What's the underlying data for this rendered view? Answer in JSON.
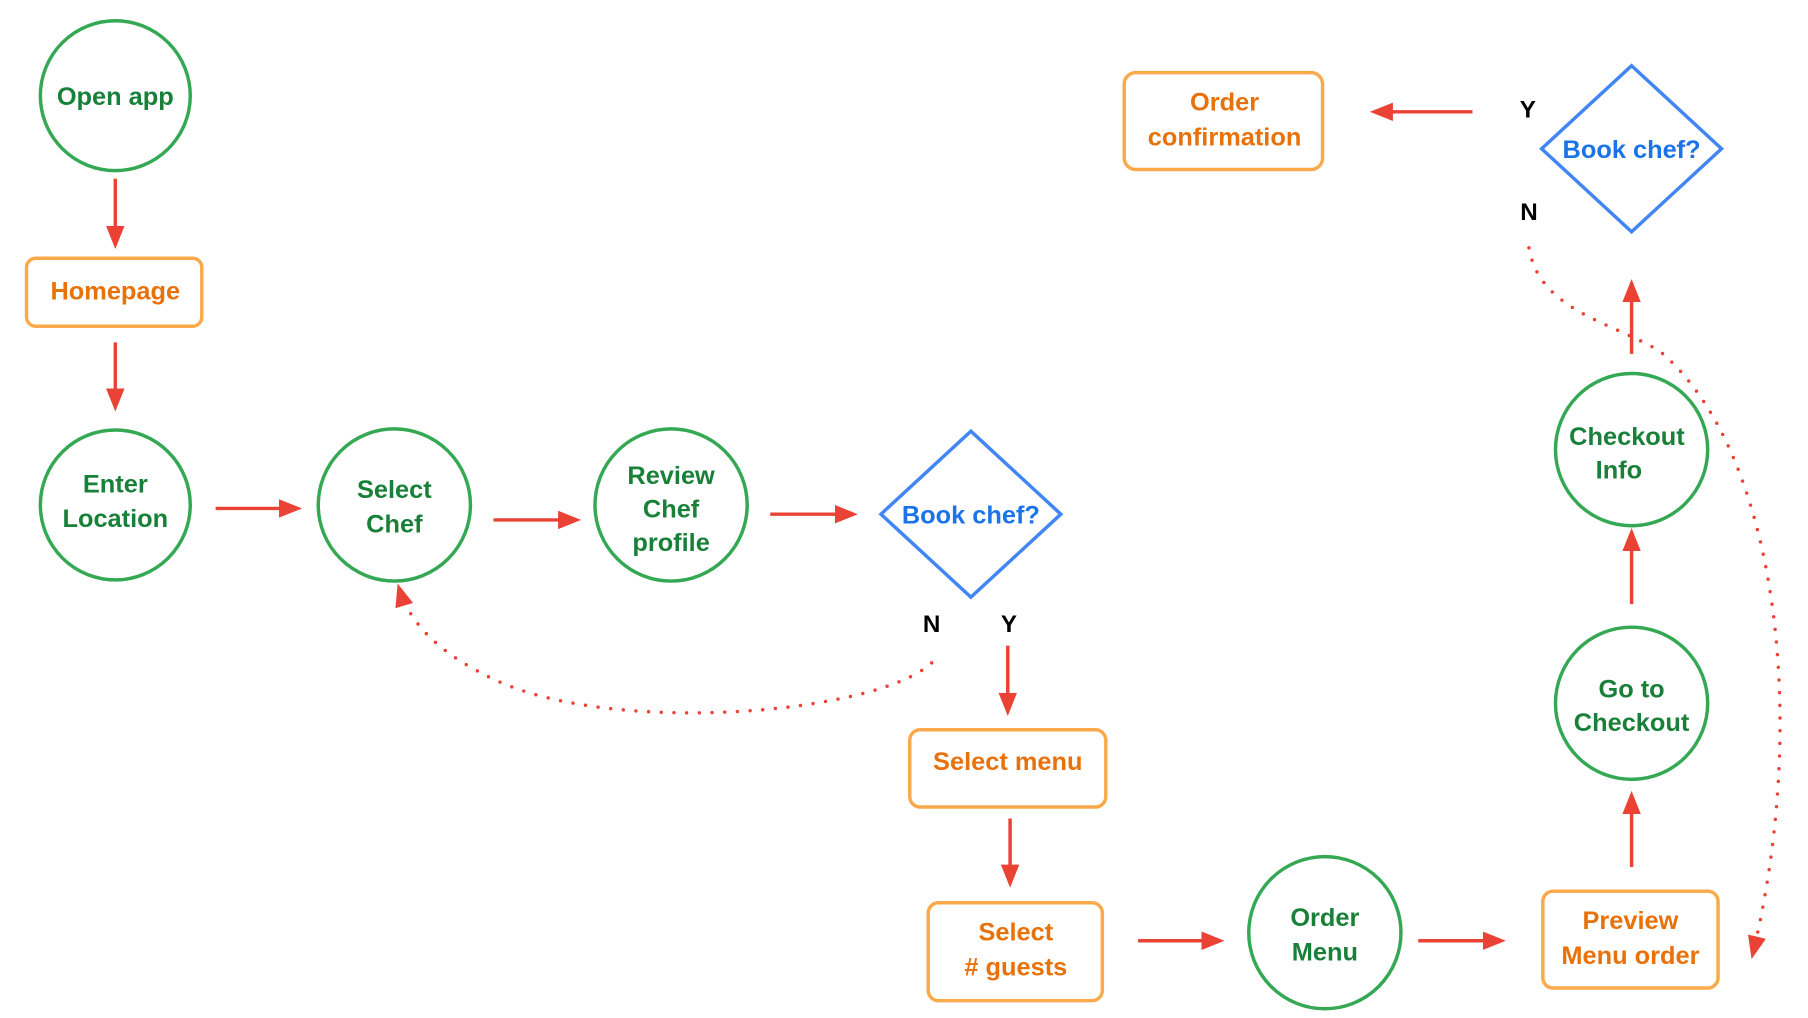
{
  "colors": {
    "process_circle": "#34a853",
    "process_text": "#188038",
    "screen_box": "#fbaa4b",
    "screen_text": "#e8710a",
    "decision": "#4285f4",
    "decision_text": "#1a73e8",
    "arrow": "#ea4335"
  },
  "nodes": {
    "open_app": [
      "Open app"
    ],
    "homepage": [
      "Homepage"
    ],
    "enter_location": [
      "Enter",
      "Location"
    ],
    "select_chef": [
      "Select",
      "Chef"
    ],
    "review_chef_profile": [
      "Review",
      "Chef",
      "profile"
    ],
    "book_chef_1": [
      "Book chef?"
    ],
    "select_menu": [
      "Select menu"
    ],
    "select_guests": [
      "Select",
      "# guests"
    ],
    "order_menu": [
      "Order",
      "Menu"
    ],
    "preview_menu_order": [
      "Preview",
      "Menu order"
    ],
    "go_to_checkout": [
      "Go to",
      "Checkout"
    ],
    "checkout_info": [
      "Checkout",
      "Info"
    ],
    "book_chef_2": [
      "Book chef?"
    ],
    "order_confirmation": [
      "Order",
      "confirmation"
    ]
  },
  "labels": {
    "decision1_no": "N",
    "decision1_yes": "Y",
    "decision2_yes": "Y",
    "decision2_no": "N"
  }
}
